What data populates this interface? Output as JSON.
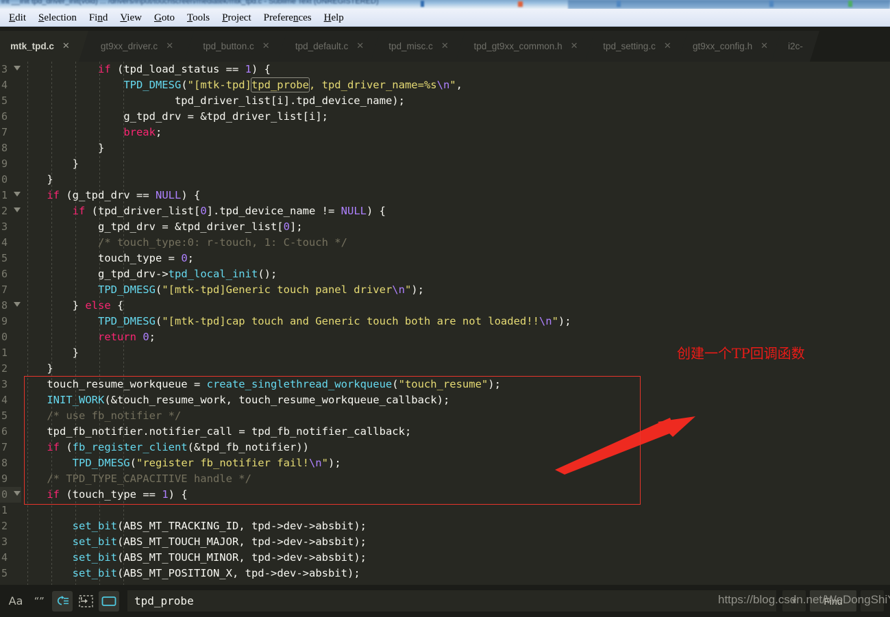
{
  "window": {
    "caption": "int __init tpd_driver_init(void) ... /drivers/input/touchscreen/mediatek/mtk_tpd.c - Sublime Text (UNREGISTERED)"
  },
  "menubar": {
    "items": [
      {
        "label": "Edit",
        "accel": "E"
      },
      {
        "label": "Selection",
        "accel": "S"
      },
      {
        "label": "Find",
        "accel": "n"
      },
      {
        "label": "View",
        "accel": "V"
      },
      {
        "label": "Goto",
        "accel": "G"
      },
      {
        "label": "Tools",
        "accel": "T"
      },
      {
        "label": "Project",
        "accel": "P"
      },
      {
        "label": "Preferences",
        "accel": "n"
      },
      {
        "label": "Help",
        "accel": "H"
      }
    ]
  },
  "tabs": [
    {
      "label": "mtk_tpd.c",
      "active": true,
      "close": "✕"
    },
    {
      "label": "gt9xx_driver.c",
      "active": false,
      "close": "✕"
    },
    {
      "label": "tpd_button.c",
      "active": false,
      "close": "✕"
    },
    {
      "label": "tpd_default.c",
      "active": false,
      "close": "✕"
    },
    {
      "label": "tpd_misc.c",
      "active": false,
      "close": "✕"
    },
    {
      "label": "tpd_gt9xx_common.h",
      "active": false,
      "close": "✕"
    },
    {
      "label": "tpd_setting.c",
      "active": false,
      "close": "✕"
    },
    {
      "label": "gt9xx_config.h",
      "active": false,
      "close": "✕"
    },
    {
      "label": "i2c-",
      "active": false,
      "close": ""
    }
  ],
  "gutter": {
    "visible_digits": [
      "3",
      "4",
      "5",
      "6",
      "7",
      "8",
      "9",
      "0",
      "1",
      "2",
      "3",
      "4",
      "5",
      "6",
      "7",
      "8",
      "9",
      "0",
      "1",
      "2",
      "3",
      "4",
      "5",
      "6",
      "7",
      "8",
      "9",
      "0",
      "1",
      "2",
      "3",
      "4",
      "5"
    ],
    "fold_rows": [
      0,
      8,
      9,
      15,
      27
    ],
    "current_row": 27
  },
  "code": {
    "lines": [
      "            if (tpd_load_status == 1) {",
      "                TPD_DMESG(\"[mtk-tpd]tpd_probe, tpd_driver_name=%s\\n\",",
      "                        tpd_driver_list[i].tpd_device_name);",
      "                g_tpd_drv = &tpd_driver_list[i];",
      "                break;",
      "            }",
      "        }",
      "    }",
      "    if (g_tpd_drv == NULL) {",
      "        if (tpd_driver_list[0].tpd_device_name != NULL) {",
      "            g_tpd_drv = &tpd_driver_list[0];",
      "            /* touch_type:0: r-touch, 1: C-touch */",
      "            touch_type = 0;",
      "            g_tpd_drv->tpd_local_init();",
      "            TPD_DMESG(\"[mtk-tpd]Generic touch panel driver\\n\");",
      "        } else {",
      "            TPD_DMESG(\"[mtk-tpd]cap touch and Generic touch both are not loaded!!\\n\");",
      "            return 0;",
      "        }",
      "    }",
      "    touch_resume_workqueue = create_singlethread_workqueue(\"touch_resume\");",
      "    INIT_WORK(&touch_resume_work, touch_resume_workqueue_callback);",
      "    /* use fb_notifier */",
      "    tpd_fb_notifier.notifier_call = tpd_fb_notifier_callback;",
      "    if (fb_register_client(&tpd_fb_notifier))",
      "        TPD_DMESG(\"register fb_notifier fail!\\n\");",
      "    /* TPD_TYPE_CAPACITIVE handle */",
      "    if (touch_type == 1) {",
      "",
      "        set_bit(ABS_MT_TRACKING_ID, tpd->dev->absbit);",
      "        set_bit(ABS_MT_TOUCH_MAJOR, tpd->dev->absbit);",
      "        set_bit(ABS_MT_TOUCH_MINOR, tpd->dev->absbit);",
      "        set_bit(ABS_MT_POSITION_X, tpd->dev->absbit);"
    ],
    "search_match": "tpd_probe"
  },
  "annotation": {
    "text": "创建一个TP回调函数",
    "box_color": "#e8352b",
    "arrow_color": "#ee2a20"
  },
  "findbar": {
    "buttons": [
      {
        "name": "case-sensitive-icon",
        "glyph": "Aa",
        "on": false
      },
      {
        "name": "whole-word-icon",
        "glyph": "“”",
        "on": false
      },
      {
        "name": "wrap-search-icon",
        "glyph": "",
        "on": true
      },
      {
        "name": "in-selection-icon",
        "glyph": "",
        "on": false
      },
      {
        "name": "highlight-results-icon",
        "glyph": "",
        "on": true
      }
    ],
    "query": "tpd_probe",
    "placeholder": "Find",
    "find_label": "Find",
    "dropdown_glyph": "▼"
  },
  "watermark": {
    "text": "https://blog.csdn.net/WoDongShiYi"
  },
  "colors": {
    "editor_bg": "#272822",
    "keyword": "#f92672",
    "function": "#66d9ef",
    "string": "#e6db74",
    "number": "#ae81ff",
    "comment": "#75715e",
    "plain": "#f8f8f2"
  }
}
